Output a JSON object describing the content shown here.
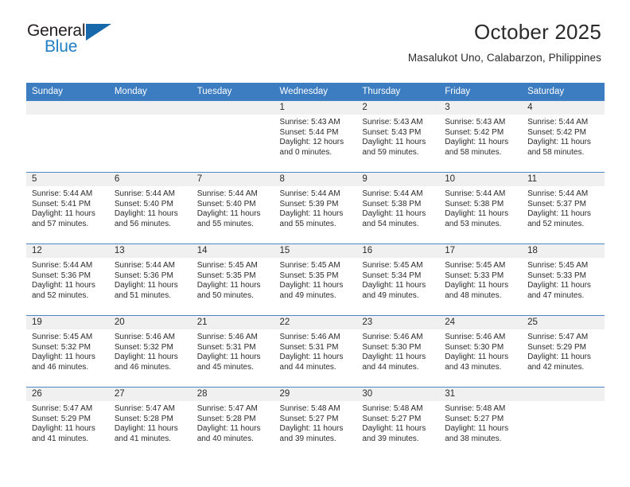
{
  "brand": {
    "name_part1": "General",
    "name_part2": "Blue",
    "triangle_color": "#1668ab",
    "blue_color": "#1f7ec4"
  },
  "header": {
    "title": "October 2025",
    "subtitle": "Masalukot Uno, Calabarzon, Philippines"
  },
  "calendar": {
    "header_bg": "#3c7cc0",
    "daynum_bg": "#f0f0f0",
    "row_border": "#4a86c5",
    "weekdays": [
      "Sunday",
      "Monday",
      "Tuesday",
      "Wednesday",
      "Thursday",
      "Friday",
      "Saturday"
    ],
    "weeks": [
      [
        {
          "day": "",
          "sunrise": "",
          "sunset": "",
          "daylight_line1": "",
          "daylight_line2": ""
        },
        {
          "day": "",
          "sunrise": "",
          "sunset": "",
          "daylight_line1": "",
          "daylight_line2": ""
        },
        {
          "day": "",
          "sunrise": "",
          "sunset": "",
          "daylight_line1": "",
          "daylight_line2": ""
        },
        {
          "day": "1",
          "sunrise": "Sunrise: 5:43 AM",
          "sunset": "Sunset: 5:44 PM",
          "daylight_line1": "Daylight: 12 hours",
          "daylight_line2": "and 0 minutes."
        },
        {
          "day": "2",
          "sunrise": "Sunrise: 5:43 AM",
          "sunset": "Sunset: 5:43 PM",
          "daylight_line1": "Daylight: 11 hours",
          "daylight_line2": "and 59 minutes."
        },
        {
          "day": "3",
          "sunrise": "Sunrise: 5:43 AM",
          "sunset": "Sunset: 5:42 PM",
          "daylight_line1": "Daylight: 11 hours",
          "daylight_line2": "and 58 minutes."
        },
        {
          "day": "4",
          "sunrise": "Sunrise: 5:44 AM",
          "sunset": "Sunset: 5:42 PM",
          "daylight_line1": "Daylight: 11 hours",
          "daylight_line2": "and 58 minutes."
        }
      ],
      [
        {
          "day": "5",
          "sunrise": "Sunrise: 5:44 AM",
          "sunset": "Sunset: 5:41 PM",
          "daylight_line1": "Daylight: 11 hours",
          "daylight_line2": "and 57 minutes."
        },
        {
          "day": "6",
          "sunrise": "Sunrise: 5:44 AM",
          "sunset": "Sunset: 5:40 PM",
          "daylight_line1": "Daylight: 11 hours",
          "daylight_line2": "and 56 minutes."
        },
        {
          "day": "7",
          "sunrise": "Sunrise: 5:44 AM",
          "sunset": "Sunset: 5:40 PM",
          "daylight_line1": "Daylight: 11 hours",
          "daylight_line2": "and 55 minutes."
        },
        {
          "day": "8",
          "sunrise": "Sunrise: 5:44 AM",
          "sunset": "Sunset: 5:39 PM",
          "daylight_line1": "Daylight: 11 hours",
          "daylight_line2": "and 55 minutes."
        },
        {
          "day": "9",
          "sunrise": "Sunrise: 5:44 AM",
          "sunset": "Sunset: 5:38 PM",
          "daylight_line1": "Daylight: 11 hours",
          "daylight_line2": "and 54 minutes."
        },
        {
          "day": "10",
          "sunrise": "Sunrise: 5:44 AM",
          "sunset": "Sunset: 5:38 PM",
          "daylight_line1": "Daylight: 11 hours",
          "daylight_line2": "and 53 minutes."
        },
        {
          "day": "11",
          "sunrise": "Sunrise: 5:44 AM",
          "sunset": "Sunset: 5:37 PM",
          "daylight_line1": "Daylight: 11 hours",
          "daylight_line2": "and 52 minutes."
        }
      ],
      [
        {
          "day": "12",
          "sunrise": "Sunrise: 5:44 AM",
          "sunset": "Sunset: 5:36 PM",
          "daylight_line1": "Daylight: 11 hours",
          "daylight_line2": "and 52 minutes."
        },
        {
          "day": "13",
          "sunrise": "Sunrise: 5:44 AM",
          "sunset": "Sunset: 5:36 PM",
          "daylight_line1": "Daylight: 11 hours",
          "daylight_line2": "and 51 minutes."
        },
        {
          "day": "14",
          "sunrise": "Sunrise: 5:45 AM",
          "sunset": "Sunset: 5:35 PM",
          "daylight_line1": "Daylight: 11 hours",
          "daylight_line2": "and 50 minutes."
        },
        {
          "day": "15",
          "sunrise": "Sunrise: 5:45 AM",
          "sunset": "Sunset: 5:35 PM",
          "daylight_line1": "Daylight: 11 hours",
          "daylight_line2": "and 49 minutes."
        },
        {
          "day": "16",
          "sunrise": "Sunrise: 5:45 AM",
          "sunset": "Sunset: 5:34 PM",
          "daylight_line1": "Daylight: 11 hours",
          "daylight_line2": "and 49 minutes."
        },
        {
          "day": "17",
          "sunrise": "Sunrise: 5:45 AM",
          "sunset": "Sunset: 5:33 PM",
          "daylight_line1": "Daylight: 11 hours",
          "daylight_line2": "and 48 minutes."
        },
        {
          "day": "18",
          "sunrise": "Sunrise: 5:45 AM",
          "sunset": "Sunset: 5:33 PM",
          "daylight_line1": "Daylight: 11 hours",
          "daylight_line2": "and 47 minutes."
        }
      ],
      [
        {
          "day": "19",
          "sunrise": "Sunrise: 5:45 AM",
          "sunset": "Sunset: 5:32 PM",
          "daylight_line1": "Daylight: 11 hours",
          "daylight_line2": "and 46 minutes."
        },
        {
          "day": "20",
          "sunrise": "Sunrise: 5:46 AM",
          "sunset": "Sunset: 5:32 PM",
          "daylight_line1": "Daylight: 11 hours",
          "daylight_line2": "and 46 minutes."
        },
        {
          "day": "21",
          "sunrise": "Sunrise: 5:46 AM",
          "sunset": "Sunset: 5:31 PM",
          "daylight_line1": "Daylight: 11 hours",
          "daylight_line2": "and 45 minutes."
        },
        {
          "day": "22",
          "sunrise": "Sunrise: 5:46 AM",
          "sunset": "Sunset: 5:31 PM",
          "daylight_line1": "Daylight: 11 hours",
          "daylight_line2": "and 44 minutes."
        },
        {
          "day": "23",
          "sunrise": "Sunrise: 5:46 AM",
          "sunset": "Sunset: 5:30 PM",
          "daylight_line1": "Daylight: 11 hours",
          "daylight_line2": "and 44 minutes."
        },
        {
          "day": "24",
          "sunrise": "Sunrise: 5:46 AM",
          "sunset": "Sunset: 5:30 PM",
          "daylight_line1": "Daylight: 11 hours",
          "daylight_line2": "and 43 minutes."
        },
        {
          "day": "25",
          "sunrise": "Sunrise: 5:47 AM",
          "sunset": "Sunset: 5:29 PM",
          "daylight_line1": "Daylight: 11 hours",
          "daylight_line2": "and 42 minutes."
        }
      ],
      [
        {
          "day": "26",
          "sunrise": "Sunrise: 5:47 AM",
          "sunset": "Sunset: 5:29 PM",
          "daylight_line1": "Daylight: 11 hours",
          "daylight_line2": "and 41 minutes."
        },
        {
          "day": "27",
          "sunrise": "Sunrise: 5:47 AM",
          "sunset": "Sunset: 5:28 PM",
          "daylight_line1": "Daylight: 11 hours",
          "daylight_line2": "and 41 minutes."
        },
        {
          "day": "28",
          "sunrise": "Sunrise: 5:47 AM",
          "sunset": "Sunset: 5:28 PM",
          "daylight_line1": "Daylight: 11 hours",
          "daylight_line2": "and 40 minutes."
        },
        {
          "day": "29",
          "sunrise": "Sunrise: 5:48 AM",
          "sunset": "Sunset: 5:27 PM",
          "daylight_line1": "Daylight: 11 hours",
          "daylight_line2": "and 39 minutes."
        },
        {
          "day": "30",
          "sunrise": "Sunrise: 5:48 AM",
          "sunset": "Sunset: 5:27 PM",
          "daylight_line1": "Daylight: 11 hours",
          "daylight_line2": "and 39 minutes."
        },
        {
          "day": "31",
          "sunrise": "Sunrise: 5:48 AM",
          "sunset": "Sunset: 5:27 PM",
          "daylight_line1": "Daylight: 11 hours",
          "daylight_line2": "and 38 minutes."
        },
        {
          "day": "",
          "sunrise": "",
          "sunset": "",
          "daylight_line1": "",
          "daylight_line2": ""
        }
      ]
    ]
  }
}
